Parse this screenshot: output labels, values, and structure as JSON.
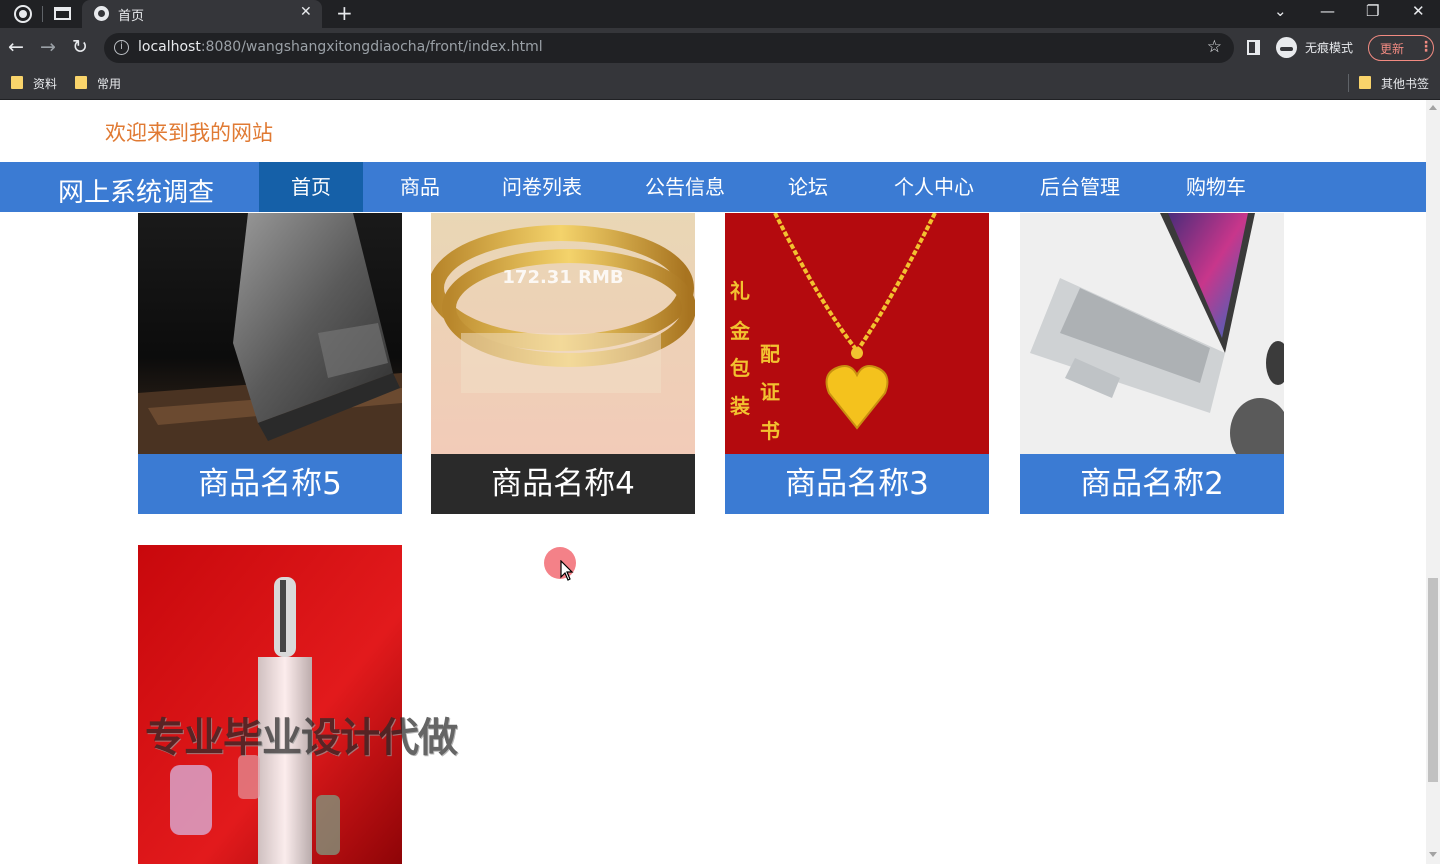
{
  "browser": {
    "tab_title": "首页",
    "tab_close": "✕",
    "new_tab": "+",
    "url_host": "localhost",
    "url_rest": ":8080/wangshangxitongdiaocha/front/index.html",
    "incognito_label": "无痕模式",
    "update_label": "更新",
    "menu_glyph": "⋮",
    "back_glyph": "←",
    "forward_glyph": "→",
    "reload_glyph": "↻",
    "star_glyph": "☆",
    "info_glyph": "i",
    "minimize_glyph": "—",
    "restore_glyph": "❐",
    "window_close_glyph": "✕",
    "tab_search_glyph": "⌄",
    "bookmarks": [
      "资料",
      "常用"
    ],
    "other_bookmarks": "其他书签"
  },
  "site": {
    "welcome": "欢迎来到我的网站",
    "brand": "网上系统调查",
    "nav": [
      "首页",
      "商品",
      "问卷列表",
      "公告信息",
      "论坛",
      "个人中心",
      "后台管理",
      "购物车"
    ],
    "active_nav": "首页",
    "products": [
      {
        "name": "商品名称5",
        "image": "laptop-dark"
      },
      {
        "name": "商品名称4",
        "image": "gold-bangle",
        "price_overlay": "172.31 RMB"
      },
      {
        "name": "商品名称3",
        "image": "gold-necklace",
        "overlay_text": [
          "礼",
          "金",
          "包",
          "装",
          "配",
          "证",
          "书"
        ]
      },
      {
        "name": "商品名称2",
        "image": "laptop-silver"
      },
      {
        "name": "",
        "image": "perfume-red"
      }
    ],
    "watermark": "专业毕业设计代做"
  },
  "colors": {
    "navbar": "#3b7bd3",
    "nav_active": "#1560a8",
    "welcome": "#e07a33",
    "caption_dark": "#2a2a2a"
  }
}
